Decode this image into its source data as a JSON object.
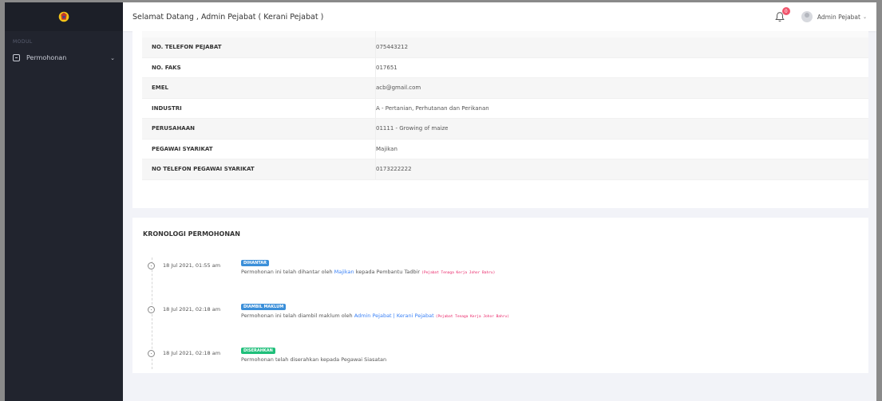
{
  "sidebar": {
    "modul_label": "MODUL",
    "items": [
      {
        "label": "Permohonan",
        "icon": "document-icon"
      }
    ]
  },
  "topbar": {
    "welcome": "Selamat Datang , Admin Pejabat ( Kerani Pejabat )",
    "notification_count": "0",
    "user_name": "Admin Pejabat"
  },
  "details": {
    "rows": [
      {
        "key": "NO. TELEFON PEJABAT",
        "value": "075443212"
      },
      {
        "key": "NO. FAKS",
        "value": "017651"
      },
      {
        "key": "EMEL",
        "value": "acb@gmail.com"
      },
      {
        "key": "INDUSTRI",
        "value": "A - Pertanian, Perhutanan dan Perikanan"
      },
      {
        "key": "PERUSAHAAN",
        "value": "01111 - Growing of maize"
      },
      {
        "key": "PEGAWAI SYARIKAT",
        "value": "Majikan"
      },
      {
        "key": "NO TELEFON PEGAWAI SYARIKAT",
        "value": "0173222222"
      }
    ]
  },
  "timeline": {
    "title": "KRONOLOGI PERMOHONAN",
    "events": [
      {
        "date": "18 Jul 2021, 01:55 am",
        "tag": "DIHANTAR",
        "tag_color": "#3b8fd9",
        "text_before": "Permohonan ini telah dihantar oleh ",
        "link": "Majikan",
        "text_after": " kepada Pembantu Tadbir ",
        "office": "(Pejabat Tenaga Kerja Johor Bahru)"
      },
      {
        "date": "18 Jul 2021, 02:18 am",
        "tag": "DIAMBIL MAKLUM",
        "tag_color": "#3b8fd9",
        "text_before": "Permohonan ini telah diambil maklum oleh ",
        "link": "Admin Pejabat | Kerani Pejabat",
        "text_after": " ",
        "office": "(Pejabat Tenaga Kerja Johor Bahru)"
      },
      {
        "date": "18 Jul 2021, 02:18 am",
        "tag": "DISERAHKAN",
        "tag_color": "#1fbf7a",
        "text_before": "Permohonan telah diserahkan kepada Pegawai Siasatan",
        "link": "",
        "text_after": "",
        "office": ""
      }
    ]
  }
}
